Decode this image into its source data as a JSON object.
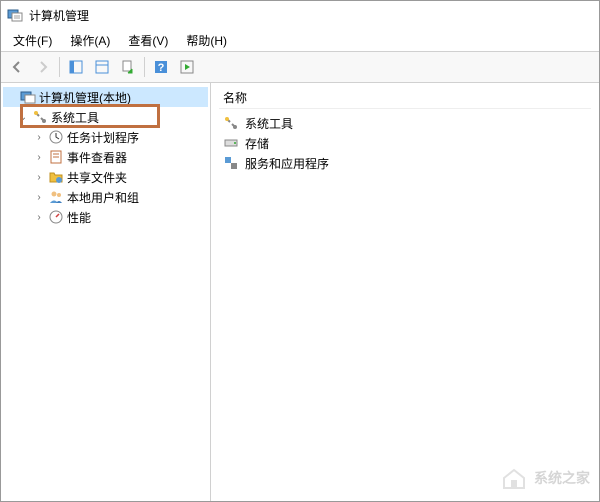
{
  "window": {
    "title": "计算机管理"
  },
  "menu": {
    "file": "文件(F)",
    "action": "操作(A)",
    "view": "查看(V)",
    "help": "帮助(H)"
  },
  "toolbar_icons": {
    "back": "back-icon",
    "forward": "forward-icon",
    "show_hide": "show-hide-icon",
    "export": "export-icon",
    "help": "help-icon",
    "run": "run-icon"
  },
  "tree": {
    "root": "计算机管理(本地)",
    "system_tools": "系统工具",
    "task_scheduler": "任务计划程序",
    "event_viewer": "事件查看器",
    "shared_folders": "共享文件夹",
    "local_users_groups": "本地用户和组",
    "performance": "性能"
  },
  "list": {
    "header_name": "名称",
    "items": {
      "system_tools": "系统工具",
      "storage": "存储",
      "services_apps": "服务和应用程序"
    }
  },
  "watermark": "系统之家"
}
